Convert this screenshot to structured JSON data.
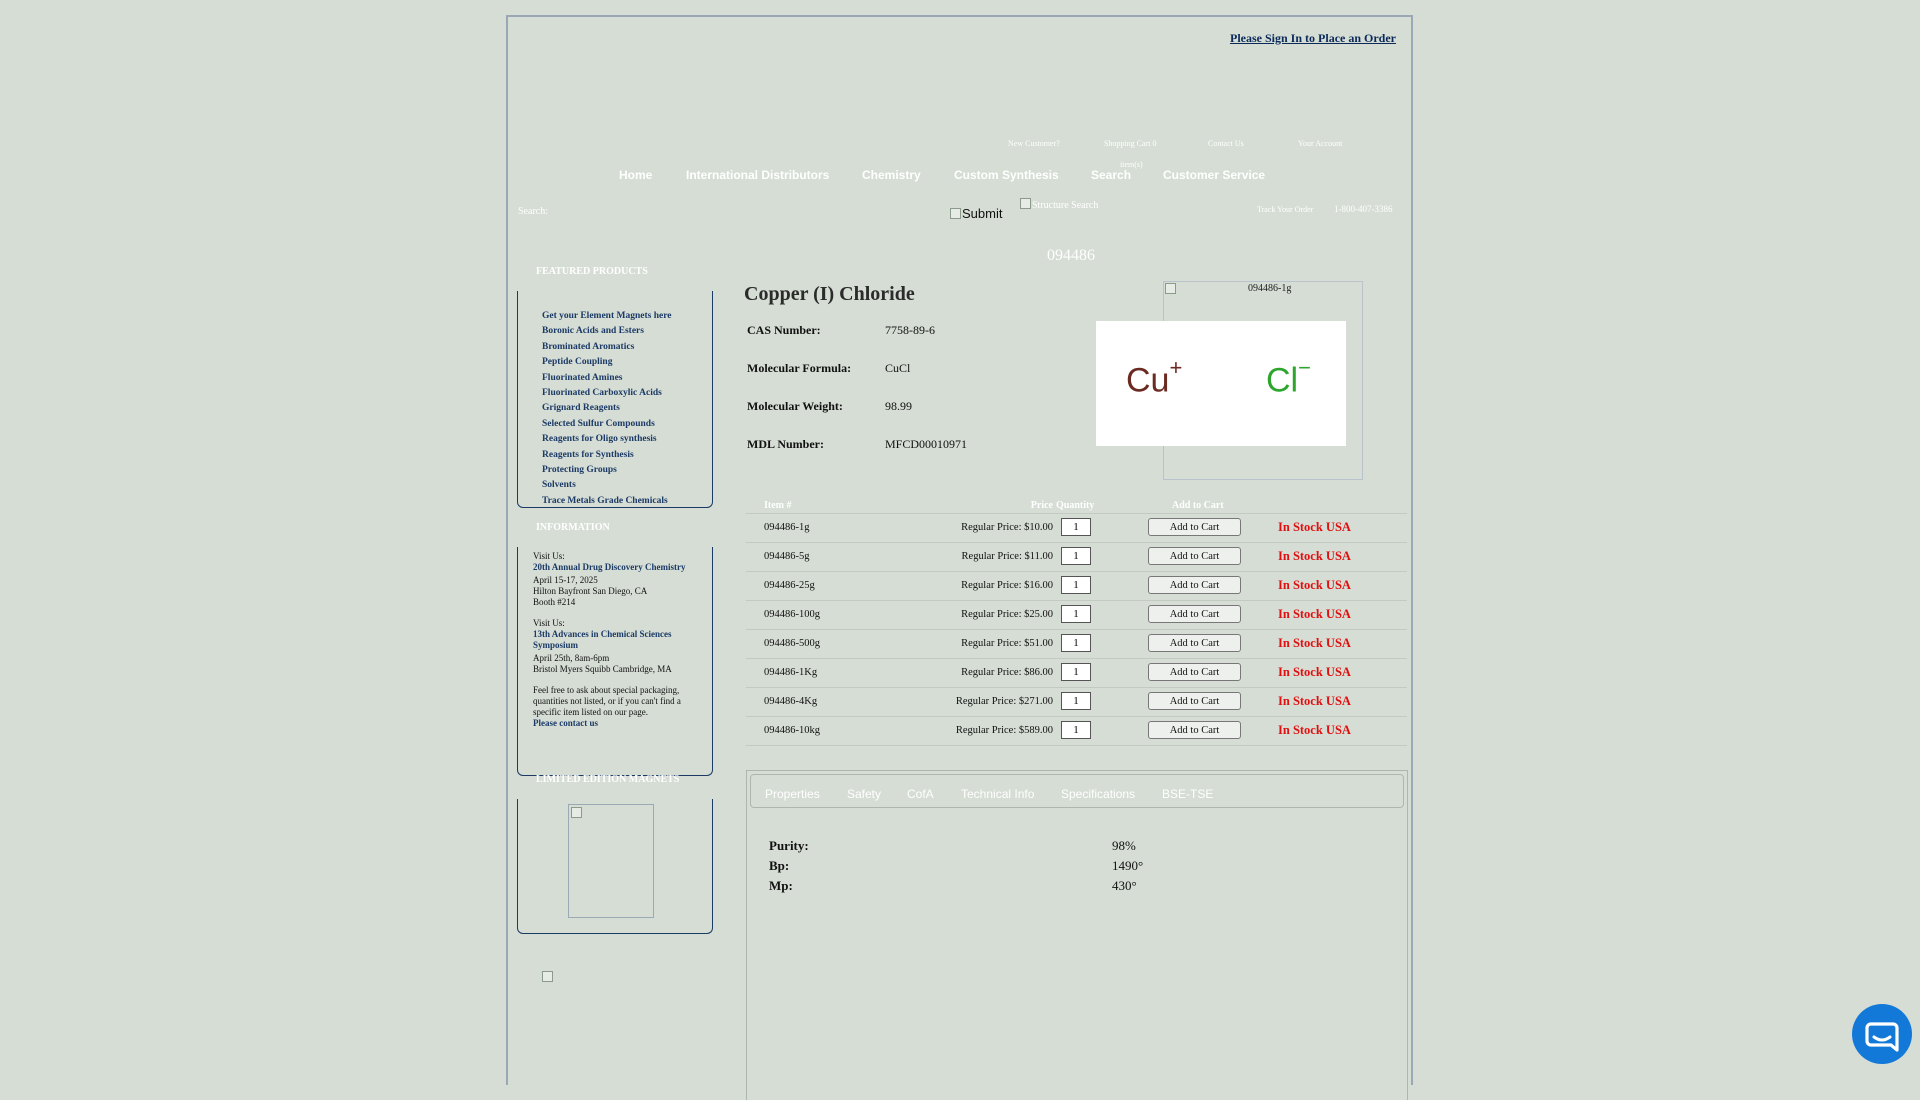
{
  "header": {
    "sign_in": "Please Sign In to Place an Order",
    "util_links": [
      "New Customer?",
      "Shopping Cart 0",
      "Contact Us",
      "Your Account"
    ],
    "cart_items": "item(s)",
    "nav": [
      "Home",
      "International Distributors",
      "Chemistry",
      "Custom Synthesis",
      "Search",
      "Customer Service"
    ],
    "search_label": "Search:",
    "search_value": "",
    "submit": "Submit",
    "structure_search": "Structure Search",
    "track_order": "Track Your Order",
    "phone": "1-800-407-3386"
  },
  "sidebar": {
    "featured_title": "FEATURED PRODUCTS",
    "featured": [
      "Get your Element Magnets here",
      "Boronic Acids and Esters",
      "Brominated Aromatics",
      "Peptide Coupling",
      "Fluorinated Amines",
      "Fluorinated Carboxylic Acids",
      "Grignard Reagents",
      "Selected Sulfur Compounds",
      "Reagents for Oligo synthesis",
      "Reagents for Synthesis",
      "Protecting Groups",
      "Solvents",
      "Trace Metals Grade Chemicals"
    ],
    "info_title": "INFORMATION",
    "visit1_label": "Visit Us:",
    "visit1_link": "20th Annual Drug Discovery Chemistry",
    "visit1_date": "April 15-17, 2025",
    "visit1_place": "Hilton Bayfront San Diego, CA",
    "visit1_booth": "Booth #214",
    "visit2_label": "Visit Us:",
    "visit2_link": "13th Advances in Chemical Sciences Symposium",
    "visit2_date": "April 25th, 8am-6pm",
    "visit2_place": "Bristol Myers Squibb Cambridge, MA",
    "contact_text": "Feel free to ask about special packaging, quantities not listed, or if you can't find a specific item listed on our page.",
    "contact_link": "Please contact us",
    "magnets_title": "LIMITED EDITION MAGNETS"
  },
  "product": {
    "number": "094486",
    "name": "Copper (I) Chloride",
    "image_caption": "094486-1g",
    "properties": [
      {
        "label": "CAS Number:",
        "value": "7758-89-6"
      },
      {
        "label": "Molecular Formula:",
        "value": "CuCl"
      },
      {
        "label": "Molecular Weight:",
        "value": "98.99"
      },
      {
        "label": "MDL Number:",
        "value": "MFCD00010971"
      }
    ],
    "structure": {
      "cation": "Cu",
      "cation_charge": "+",
      "anion": "Cl",
      "anion_charge": "−"
    }
  },
  "table": {
    "headers": {
      "item": "Item #",
      "price": "Price",
      "quantity": "Quantity",
      "add": "Add to Cart"
    },
    "rows": [
      {
        "item": "094486-1g",
        "price": "Regular Price: $10.00",
        "qty": "1",
        "button": "Add to Cart",
        "stock": "In Stock USA"
      },
      {
        "item": "094486-5g",
        "price": "Regular Price: $11.00",
        "qty": "1",
        "button": "Add to Cart",
        "stock": "In Stock USA"
      },
      {
        "item": "094486-25g",
        "price": "Regular Price: $16.00",
        "qty": "1",
        "button": "Add to Cart",
        "stock": "In Stock USA"
      },
      {
        "item": "094486-100g",
        "price": "Regular Price: $25.00",
        "qty": "1",
        "button": "Add to Cart",
        "stock": "In Stock USA"
      },
      {
        "item": "094486-500g",
        "price": "Regular Price: $51.00",
        "qty": "1",
        "button": "Add to Cart",
        "stock": "In Stock USA"
      },
      {
        "item": "094486-1Kg",
        "price": "Regular Price: $86.00",
        "qty": "1",
        "button": "Add to Cart",
        "stock": "In Stock USA"
      },
      {
        "item": "094486-4Kg",
        "price": "Regular Price: $271.00",
        "qty": "1",
        "button": "Add to Cart",
        "stock": "In Stock USA"
      },
      {
        "item": "094486-10kg",
        "price": "Regular Price: $589.00",
        "qty": "1",
        "button": "Add to Cart",
        "stock": "In Stock USA"
      }
    ]
  },
  "tabs": [
    "Properties",
    "Safety",
    "CofA",
    "Technical Info",
    "Specifications",
    "BSE-TSE"
  ],
  "props": [
    {
      "label": "Purity:",
      "value": "98%"
    },
    {
      "label": "Bp:",
      "value": "1490°"
    },
    {
      "label": "Mp:",
      "value": "430°"
    }
  ],
  "colors": {
    "stock": "#e01010",
    "link": "#1b3a66",
    "chat": "#1279d8"
  }
}
